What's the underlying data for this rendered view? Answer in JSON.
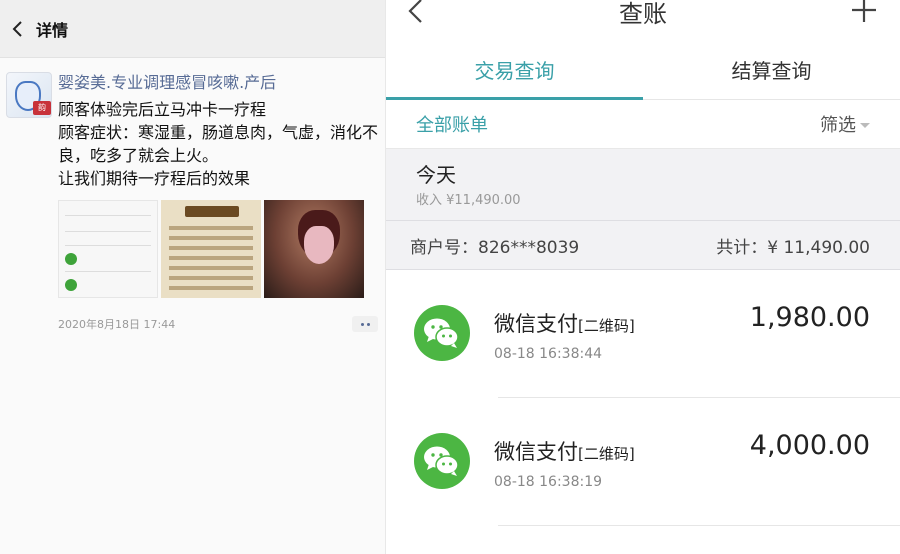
{
  "left": {
    "header_title": "详情",
    "post": {
      "username": "婴姿美.专业调理感冒咳嗽.产后",
      "lines": [
        "顾客体验完后立马冲卡一疗程",
        "顾客症状：寒湿重，肠道息肉，气虚，消化不良，吃多了就会上火。",
        "让我们期待一疗程后的效果"
      ],
      "date": "2020年8月18日 17:44"
    }
  },
  "right": {
    "title": "查账",
    "tabs": [
      "交易查询",
      "结算查询"
    ],
    "filter_left": "全部账单",
    "filter_right": "筛选",
    "day": {
      "title": "今天",
      "subtitle": "收入  ¥11,490.00"
    },
    "merchant": {
      "id_label": "商户号：826***8039",
      "total_label": "共计：¥ 11,490.00"
    },
    "transactions": [
      {
        "name": "微信支付",
        "type": "[二维码]",
        "time": "08-18 16:38:44",
        "amount": "1,980.00"
      },
      {
        "name": "微信支付",
        "type": "[二维码]",
        "time": "08-18 16:38:19",
        "amount": "4,000.00"
      }
    ],
    "colors": {
      "accent": "#3aa0a8",
      "wechat_green": "#4cb643"
    }
  }
}
